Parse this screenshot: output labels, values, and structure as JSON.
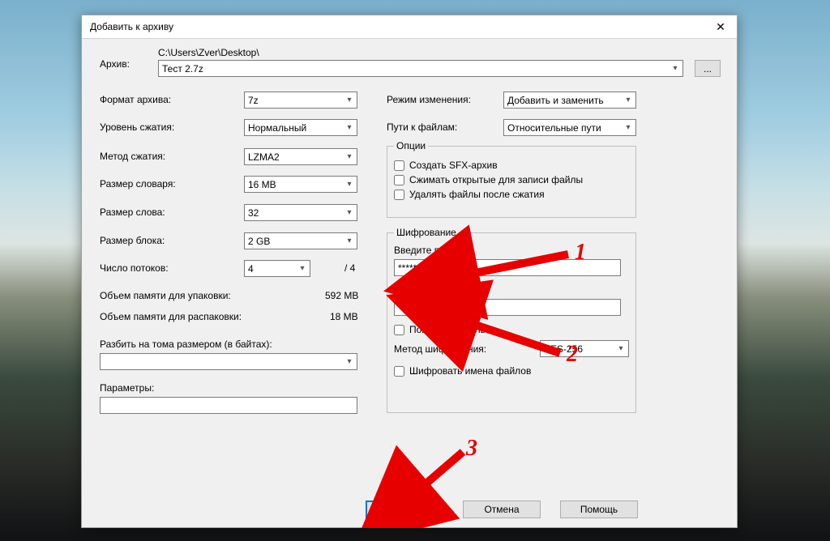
{
  "window": {
    "title": "Добавить к архиву",
    "close_glyph": "✕"
  },
  "archive": {
    "label": "Архив:",
    "path": "C:\\Users\\Zver\\Desktop\\",
    "filename": "Тест 2.7z",
    "browse_label": "..."
  },
  "left": {
    "format_label": "Формат архива:",
    "format_value": "7z",
    "level_label": "Уровень сжатия:",
    "level_value": "Нормальный",
    "method_label": "Метод сжатия:",
    "method_value": "LZMA2",
    "dict_label": "Размер словаря:",
    "dict_value": "16 MB",
    "word_label": "Размер слова:",
    "word_value": "32",
    "block_label": "Размер блока:",
    "block_value": "2 GB",
    "threads_label": "Число потоков:",
    "threads_value": "4",
    "threads_max": "/ 4",
    "mem_pack_label": "Объем памяти для упаковки:",
    "mem_pack_value": "592 MB",
    "mem_unpack_label": "Объем памяти для распаковки:",
    "mem_unpack_value": "18 MB",
    "split_label": "Разбить на тома размером (в байтах):",
    "split_value": "",
    "params_label": "Параметры:",
    "params_value": ""
  },
  "right": {
    "update_mode_label": "Режим изменения:",
    "update_mode_value": "Добавить и заменить",
    "path_mode_label": "Пути к файлам:",
    "path_mode_value": "Относительные пути",
    "options_legend": "Опции",
    "opt_sfx": "Создать SFX-архив",
    "opt_open": "Сжимать открытые для записи файлы",
    "opt_delete": "Удалять файлы после сжатия",
    "encryption_legend": "Шифрование",
    "enc_enter_label": "Введите пароль:",
    "enc_enter_value": "******",
    "enc_repeat_label": "Повторите пароль:",
    "enc_repeat_value": "******",
    "enc_show": "Показать пароль",
    "enc_method_label": "Метод шифрования:",
    "enc_method_value": "AES-256",
    "enc_names": "Шифровать имена файлов"
  },
  "buttons": {
    "ok": "OK",
    "cancel": "Отмена",
    "help": "Помощь"
  },
  "annotations": {
    "n1": "1",
    "n2": "2",
    "n3": "3"
  }
}
